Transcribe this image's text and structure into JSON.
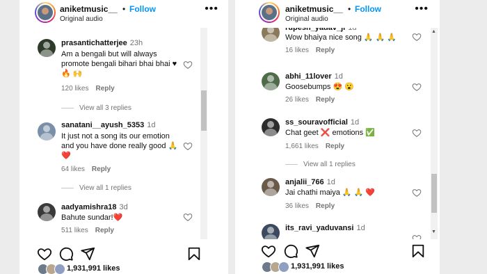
{
  "left": {
    "header": {
      "username": "aniketmusic__",
      "separator": "•",
      "follow": "Follow",
      "subtitle": "Original audio"
    },
    "comments": [
      {
        "user": "prasantichatterjee",
        "time": "23h",
        "text": "Am a bengali but will always\npromote bengali bihari bhai bhai ♥\n🔥 🙌",
        "likes": "120 likes",
        "reply": "Reply",
        "avatar_color": "#2f3b2a"
      },
      {
        "user": "sanatani__ayush_5353",
        "time": "1d",
        "text": "It just not a song its our emotion\nand you have done really good 🙏\n❤️",
        "likes": "64 likes",
        "reply": "Reply",
        "avatar_color": "#7a8fa8"
      },
      {
        "user": "aadyamishra18",
        "time": "3d",
        "text": "Bahute sundar!❤️",
        "likes": "511 likes",
        "reply": "Reply",
        "avatar_color": "#3a3a3a"
      }
    ],
    "view_replies": [
      "View all 3 replies",
      "View all 1 replies"
    ],
    "actions": {
      "likes": "1,931,991 likes"
    }
  },
  "right": {
    "header": {
      "username": "aniketmusic__",
      "separator": "•",
      "follow": "Follow",
      "subtitle": "Original audio"
    },
    "comments": [
      {
        "user": "rupesh_yadav_ji",
        "time": "1d",
        "text": "Wow bhaiya nice song 🙏 🙏 🙏",
        "likes": "16 likes",
        "reply": "Reply",
        "avatar_color": "#8a7a5a"
      },
      {
        "user": "abhi_11lover",
        "time": "1d",
        "text": "Goosebumps 😍 😮",
        "likes": "26 likes",
        "reply": "Reply",
        "avatar_color": "#4f6b4a"
      },
      {
        "user": "ss_souravofficial",
        "time": "1d",
        "text": "Chat geet ❌ emotions ✅",
        "likes": "1,661 likes",
        "reply": "Reply",
        "avatar_color": "#2c2c2c"
      },
      {
        "user": "anjalii_766",
        "time": "1d",
        "text": "Jai chathi maiya 🙏 🙏 ❤️",
        "likes": "36 likes",
        "reply": "Reply",
        "avatar_color": "#6a5a4a"
      },
      {
        "user": "its_ravi_yaduvansi",
        "time": "1d",
        "text": "",
        "likes": "",
        "reply": "",
        "avatar_color": "#3b4a5e"
      }
    ],
    "view_replies": [
      "View all 1 replies"
    ],
    "actions": {
      "likes": "1,931,991 likes"
    }
  },
  "icons": [
    "heart-icon",
    "comment-icon",
    "share-icon",
    "bookmark-icon",
    "more-options-icon"
  ],
  "colors": {
    "follow": "#0095f6",
    "muted": "#737373",
    "heart_red": "#ed4956"
  }
}
